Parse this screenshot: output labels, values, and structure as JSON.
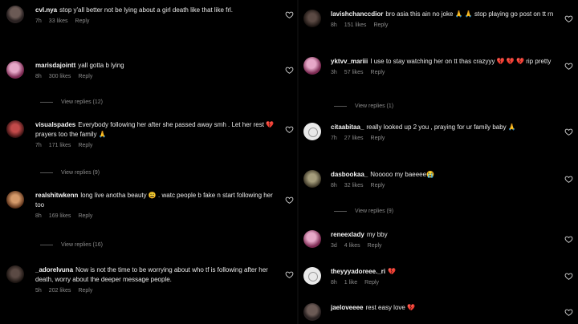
{
  "left": [
    {
      "username": "cvl.nya",
      "text": "stop y'all better not be lying about a girl death like that like frl.",
      "time": "7h",
      "likes": "33 likes",
      "reply": "Reply",
      "avatar": "grey",
      "replies": null
    },
    {
      "username": "marisdajointt",
      "text": "yall gotta b lying",
      "time": "8h",
      "likes": "300 likes",
      "reply": "Reply",
      "avatar": "pink",
      "replies": "View replies (12)"
    },
    {
      "username": "visualspades",
      "text": "Everybody following her after she passed away smh . Let her rest 💔 prayers too the family 🙏",
      "time": "7h",
      "likes": "171 likes",
      "reply": "Reply",
      "avatar": "red",
      "replies": "View replies (9)"
    },
    {
      "username": "realshitwkenn",
      "text": "long live anotha beauty 😩 . watc people b fake n start following her too",
      "time": "8h",
      "likes": "169 likes",
      "reply": "Reply",
      "avatar": "warm",
      "replies": "View replies (16)"
    },
    {
      "username": "_adorelvuna",
      "text": "Now is not the time to be worrying about who tf is following after her death, worry about the deeper message people.",
      "time": "5h",
      "likes": "202 likes",
      "reply": "Reply",
      "avatar": "dark",
      "replies": null
    }
  ],
  "right": [
    {
      "username": "lavishchanccdior",
      "text": "bro asia this ain no joke 🙏 🙏 stop playing go post on tt rn",
      "time": "8h",
      "likes": "151 likes",
      "reply": "Reply",
      "avatar": "dark",
      "replies": null
    },
    {
      "username": "yktvv_mariii",
      "text": "I use to stay watching her on tt thas crazyyy 💔 💔 💔 rip pretty",
      "time": "3h",
      "likes": "57 likes",
      "reply": "Reply",
      "avatar": "pink",
      "replies": "View replies (1)"
    },
    {
      "username": "citaabitaa_",
      "text": "really looked up 2 you , praying for ur family baby 🙏",
      "time": "7h",
      "likes": "27 likes",
      "reply": "Reply",
      "avatar": "default",
      "replies": null
    },
    {
      "username": "dasbookaa_",
      "text": "Nooooo my baeeee😭",
      "time": "8h",
      "likes": "32 likes",
      "reply": "Reply",
      "avatar": "olive",
      "replies": "View replies (9)"
    },
    {
      "username": "reneexlady",
      "text": "my bby",
      "time": "3d",
      "likes": "4 likes",
      "reply": "Reply",
      "avatar": "pink",
      "replies": null
    },
    {
      "username": "theyyyadoreee._ri",
      "text": "💔",
      "time": "8h",
      "likes": "1 like",
      "reply": "Reply",
      "avatar": "default",
      "replies": null
    },
    {
      "username": "jaeloveeee",
      "text": "rest easy love 💔",
      "time": "",
      "likes": "",
      "reply": "",
      "avatar": "grey",
      "replies": null
    }
  ],
  "icons": {
    "like": "heart-outline-icon"
  },
  "colors": {
    "background": "#000000",
    "text": "#eaeaea",
    "meta": "#8a8a8a",
    "heart": "#e0245e"
  }
}
